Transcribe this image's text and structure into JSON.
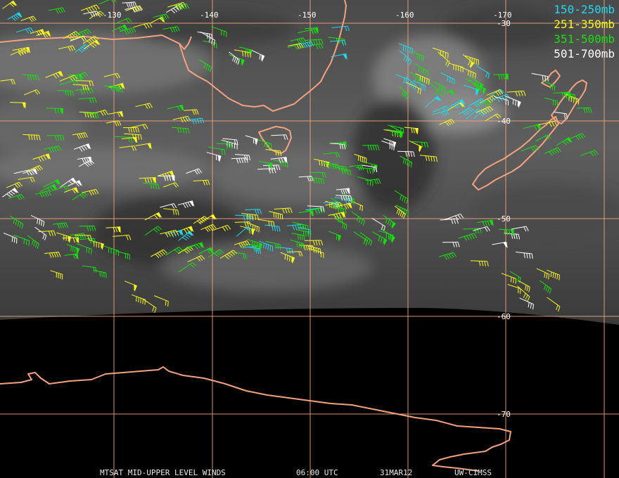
{
  "colors": {
    "grid": "#f2a27e",
    "coast": "#f2a27e",
    "band_150_250": "#20d8f0",
    "band_251_350": "#f8f820",
    "band_351_500": "#18e010",
    "band_501_700": "#ffffff",
    "space": "#000000",
    "footer_text": "#e8e8e8"
  },
  "legend": {
    "entries": [
      {
        "label": "150-250mb",
        "color": "#20d8f0"
      },
      {
        "label": "251-350mb",
        "color": "#f8f820"
      },
      {
        "label": "351-500mb",
        "color": "#18e010"
      },
      {
        "label": "501-700mb",
        "color": "#ffffff"
      }
    ]
  },
  "grid_labels": {
    "longitudes": [
      "-130",
      "-140",
      "-150",
      "-160",
      "-170"
    ],
    "latitudes": [
      "-30",
      "-40",
      "-50",
      "-60",
      "-70"
    ]
  },
  "footer": {
    "product": "MTSAT MID-UPPER LEVEL WINDS",
    "time": "06:00 UTC",
    "date": "31MAR12",
    "source": "UW-CIMSS"
  }
}
